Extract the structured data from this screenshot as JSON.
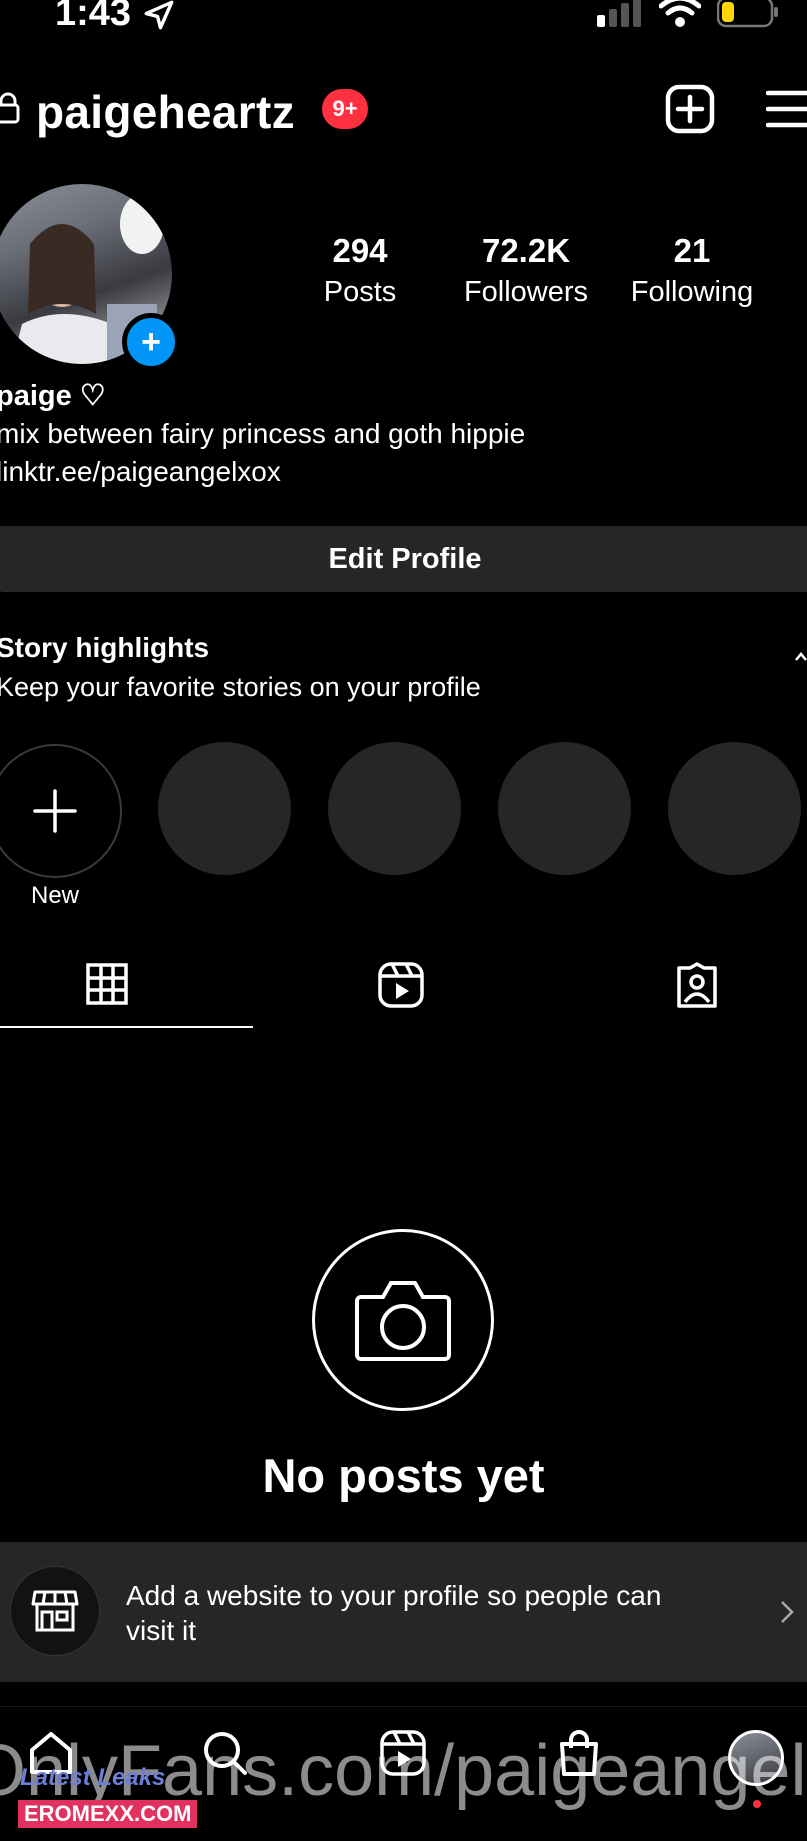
{
  "status_bar": {
    "time": "1:43"
  },
  "header": {
    "username": "paigeheartz",
    "notification_badge": "9+"
  },
  "stats": [
    {
      "value": "294",
      "label": "Posts"
    },
    {
      "value": "72.2K",
      "label": "Followers"
    },
    {
      "value": "21",
      "label": "Following"
    }
  ],
  "profile": {
    "name": "paige ♡",
    "bio": "mix between fairy princess and goth hippie",
    "link": "linktr.ee/paigeangelxox"
  },
  "edit_profile_label": "Edit Profile",
  "highlights": {
    "title": "Story highlights",
    "subtitle": "Keep your favorite stories on your profile",
    "new_label": "New"
  },
  "empty_state": {
    "title": "No posts yet"
  },
  "website_prompt": {
    "text": "Add a website to your profile so people can visit it"
  },
  "watermark": {
    "text": "OnlyFans.com/paigeangelx",
    "logo_top": "Latest Leaks",
    "logo_bottom": "EROMEXX.COM"
  },
  "colors": {
    "accent_blue": "#0095f6",
    "badge_red": "#ff3040",
    "card_bg": "#262626"
  }
}
